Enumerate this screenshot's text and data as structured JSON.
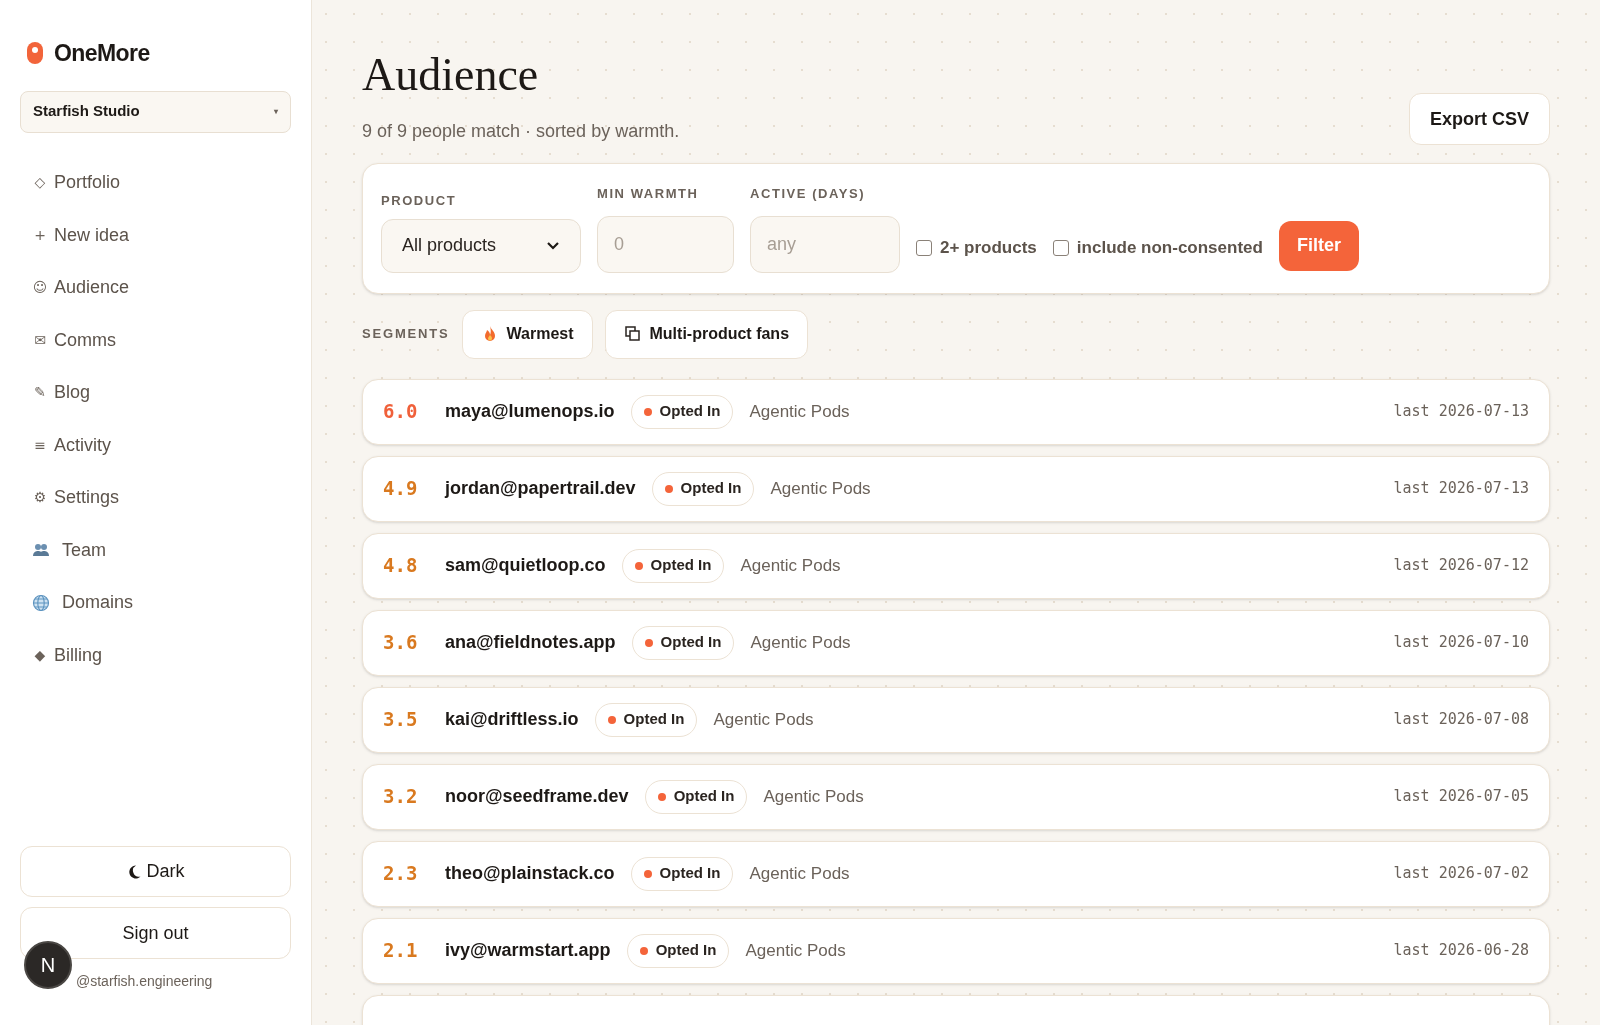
{
  "brand": {
    "name": "OneMore"
  },
  "workspace": {
    "label": "Starfish Studio",
    "caret": "▾"
  },
  "nav": [
    {
      "label": "Portfolio",
      "kind": "glyph",
      "icon": "◇"
    },
    {
      "label": "New idea",
      "kind": "glyph",
      "icon": "+"
    },
    {
      "label": "Audience",
      "kind": "glyph",
      "icon": "☺"
    },
    {
      "label": "Comms",
      "kind": "glyph",
      "icon": "✉"
    },
    {
      "label": "Blog",
      "kind": "glyph",
      "icon": "✎"
    },
    {
      "label": "Activity",
      "kind": "glyph",
      "icon": "≡"
    },
    {
      "label": "Settings",
      "kind": "glyph",
      "icon": "⚙"
    },
    {
      "label": "Team",
      "kind": "team"
    },
    {
      "label": "Domains",
      "kind": "globe"
    },
    {
      "label": "Billing",
      "kind": "glyph",
      "icon": "◆"
    }
  ],
  "theme_button": {
    "label": "Dark"
  },
  "signout_button": {
    "label": "Sign out"
  },
  "user_email": "@starfish.engineering",
  "dev_badge": "N",
  "page": {
    "title": "Audience",
    "subtitle": "9 of 9 people match · sorted by warmth.",
    "export_button": "Export CSV"
  },
  "filters": {
    "product": {
      "label": "PRODUCT",
      "value": "All products"
    },
    "min_warmth": {
      "label": "MIN WARMTH",
      "placeholder": "0"
    },
    "active_days": {
      "label": "ACTIVE (DAYS)",
      "placeholder": "any"
    },
    "checkboxes": [
      {
        "label": "2+ products",
        "checked": false
      },
      {
        "label": "include non-consented",
        "checked": false
      }
    ],
    "button": "Filter"
  },
  "segments": {
    "label": "SEGMENTS",
    "items": [
      {
        "label": "Warmest",
        "kind": "flame"
      },
      {
        "label": "Multi-product fans",
        "kind": "copy"
      }
    ]
  },
  "rows": [
    {
      "score": "6.0",
      "color": "#f0603a",
      "email": "maya@lumenops.io",
      "status": "Opted In",
      "product": "Agentic Pods",
      "last": "last 2026-07-13"
    },
    {
      "score": "4.9",
      "color": "#d9791f",
      "email": "jordan@papertrail.dev",
      "status": "Opted In",
      "product": "Agentic Pods",
      "last": "last 2026-07-13"
    },
    {
      "score": "4.8",
      "color": "#d9791f",
      "email": "sam@quietloop.co",
      "status": "Opted In",
      "product": "Agentic Pods",
      "last": "last 2026-07-12"
    },
    {
      "score": "3.6",
      "color": "#d9791f",
      "email": "ana@fieldnotes.app",
      "status": "Opted In",
      "product": "Agentic Pods",
      "last": "last 2026-07-10"
    },
    {
      "score": "3.5",
      "color": "#d9791f",
      "email": "kai@driftless.io",
      "status": "Opted In",
      "product": "Agentic Pods",
      "last": "last 2026-07-08"
    },
    {
      "score": "3.2",
      "color": "#d9791f",
      "email": "noor@seedframe.dev",
      "status": "Opted In",
      "product": "Agentic Pods",
      "last": "last 2026-07-05"
    },
    {
      "score": "2.3",
      "color": "#d9791f",
      "email": "theo@plainstack.co",
      "status": "Opted In",
      "product": "Agentic Pods",
      "last": "last 2026-07-02"
    },
    {
      "score": "2.1",
      "color": "#d9791f",
      "email": "ivy@warmstart.app",
      "status": "Opted In",
      "product": "Agentic Pods",
      "last": "last 2026-06-28"
    }
  ],
  "more_rows_below": true
}
